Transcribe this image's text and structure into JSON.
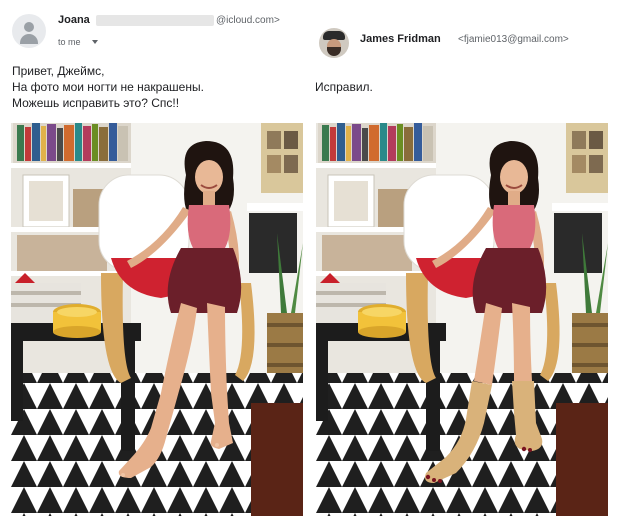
{
  "left_email": {
    "sender_name": "Joana",
    "sender_email": "@icloud.com>",
    "recipient": "to me",
    "message_lines": [
      "Привет, Джеймс,",
      "На фото мои ногти не накрашены.",
      "Можешь исправить это? Спс!!"
    ]
  },
  "right_email": {
    "sender_name": "James Fridman",
    "sender_email": "<fjamie013@gmail.com>",
    "message": "Исправил."
  },
  "colors": {
    "text": "#202124",
    "meta": "#5f6368",
    "top_color": "#d96a7a",
    "skirt_color": "#6b1f2a",
    "cushion_color": "#cf2230",
    "bowl_color": "#f2c23a"
  }
}
